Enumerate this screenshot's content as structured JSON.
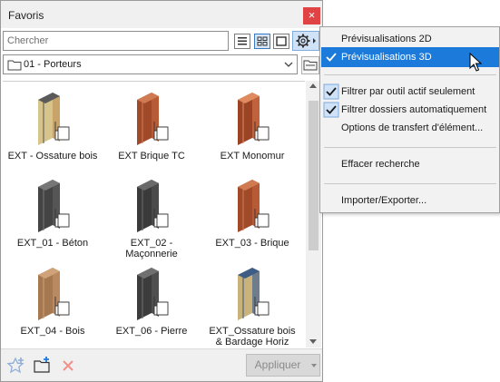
{
  "window": {
    "title": "Favoris"
  },
  "search": {
    "placeholder": "Chercher",
    "value": ""
  },
  "folder": {
    "selected": "01 - Porteurs"
  },
  "items": [
    {
      "name": "EXT - Ossature bois",
      "material": "wood-frame"
    },
    {
      "name": "EXT Brique TC",
      "material": "brick"
    },
    {
      "name": "EXT Monomur",
      "material": "monomur"
    },
    {
      "name": "EXT_01 - Béton",
      "material": "concrete"
    },
    {
      "name": "EXT_02 -\nMaçonnerie",
      "material": "masonry"
    },
    {
      "name": "EXT_03 - Brique",
      "material": "brick"
    },
    {
      "name": "EXT_04 - Bois",
      "material": "wood"
    },
    {
      "name": "EXT_06 - Pierre",
      "material": "stone"
    },
    {
      "name": "EXT_Ossature bois\n& Bardage Horiz",
      "material": "cladding"
    }
  ],
  "bottombar": {
    "apply_label": "Appliquer"
  },
  "menu": {
    "items": [
      {
        "label": "Prévisualisations 2D",
        "checked": false,
        "highlighted": false
      },
      {
        "label": "Prévisualisations 3D",
        "checked": true,
        "highlighted": true
      },
      {
        "label": "Filtrer par outil actif seulement",
        "checked": true,
        "highlighted": false
      },
      {
        "label": "Filtrer dossiers automatiquement",
        "checked": true,
        "highlighted": false
      },
      {
        "label": "Options de transfert d'élément...",
        "checked": false,
        "highlighted": false
      },
      {
        "label": "Effacer recherche",
        "checked": false,
        "highlighted": false
      },
      {
        "label": "Importer/Exporter...",
        "checked": false,
        "highlighted": false
      }
    ]
  },
  "colors": {
    "accent": "#1c7adb",
    "close": "#e04343",
    "check": "#1c7adb"
  },
  "icons": {
    "close": "close-icon",
    "list_view": "list-view-icon",
    "grid_view": "grid-view-icon",
    "large_view": "large-preview-icon",
    "settings": "gear-icon",
    "folder": "folder-icon",
    "open_folder": "folder-browse-icon",
    "add_favorite": "add-favorite-icon",
    "new_folder": "new-folder-icon",
    "delete": "delete-icon"
  }
}
